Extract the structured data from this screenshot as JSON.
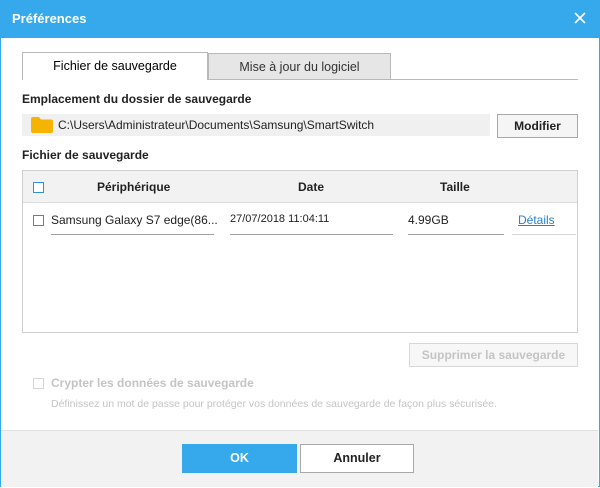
{
  "window": {
    "title": "Préférences"
  },
  "tabs": [
    {
      "label": "Fichier de sauvegarde",
      "active": true
    },
    {
      "label": "Mise à jour du logiciel",
      "active": false
    }
  ],
  "backup_location": {
    "label": "Emplacement du dossier de sauvegarde",
    "path": "C:\\Users\\Administrateur\\Documents\\Samsung\\SmartSwitch",
    "modify_label": "Modifier"
  },
  "backup_files": {
    "label": "Fichier de sauvegarde",
    "columns": [
      "Périphérique",
      "Date",
      "Taille"
    ],
    "rows": [
      {
        "device": "Samsung Galaxy S7 edge(86...",
        "date": "27/07/2018 11:04:11",
        "size": "4.99GB",
        "details": "Détails"
      }
    ],
    "delete_label": "Supprimer la sauvegarde"
  },
  "encrypt": {
    "label": "Crypter les données de sauvegarde",
    "description": "Définissez un mot de passe pour protéger vos données de sauvegarde de façon plus sécurisée."
  },
  "footer": {
    "ok_label": "OK",
    "cancel_label": "Annuler"
  },
  "colors": {
    "accent": "#35a9ec",
    "link": "#2b7fc8",
    "folder": "#f5b400",
    "disabled": "#c4c4c4"
  }
}
